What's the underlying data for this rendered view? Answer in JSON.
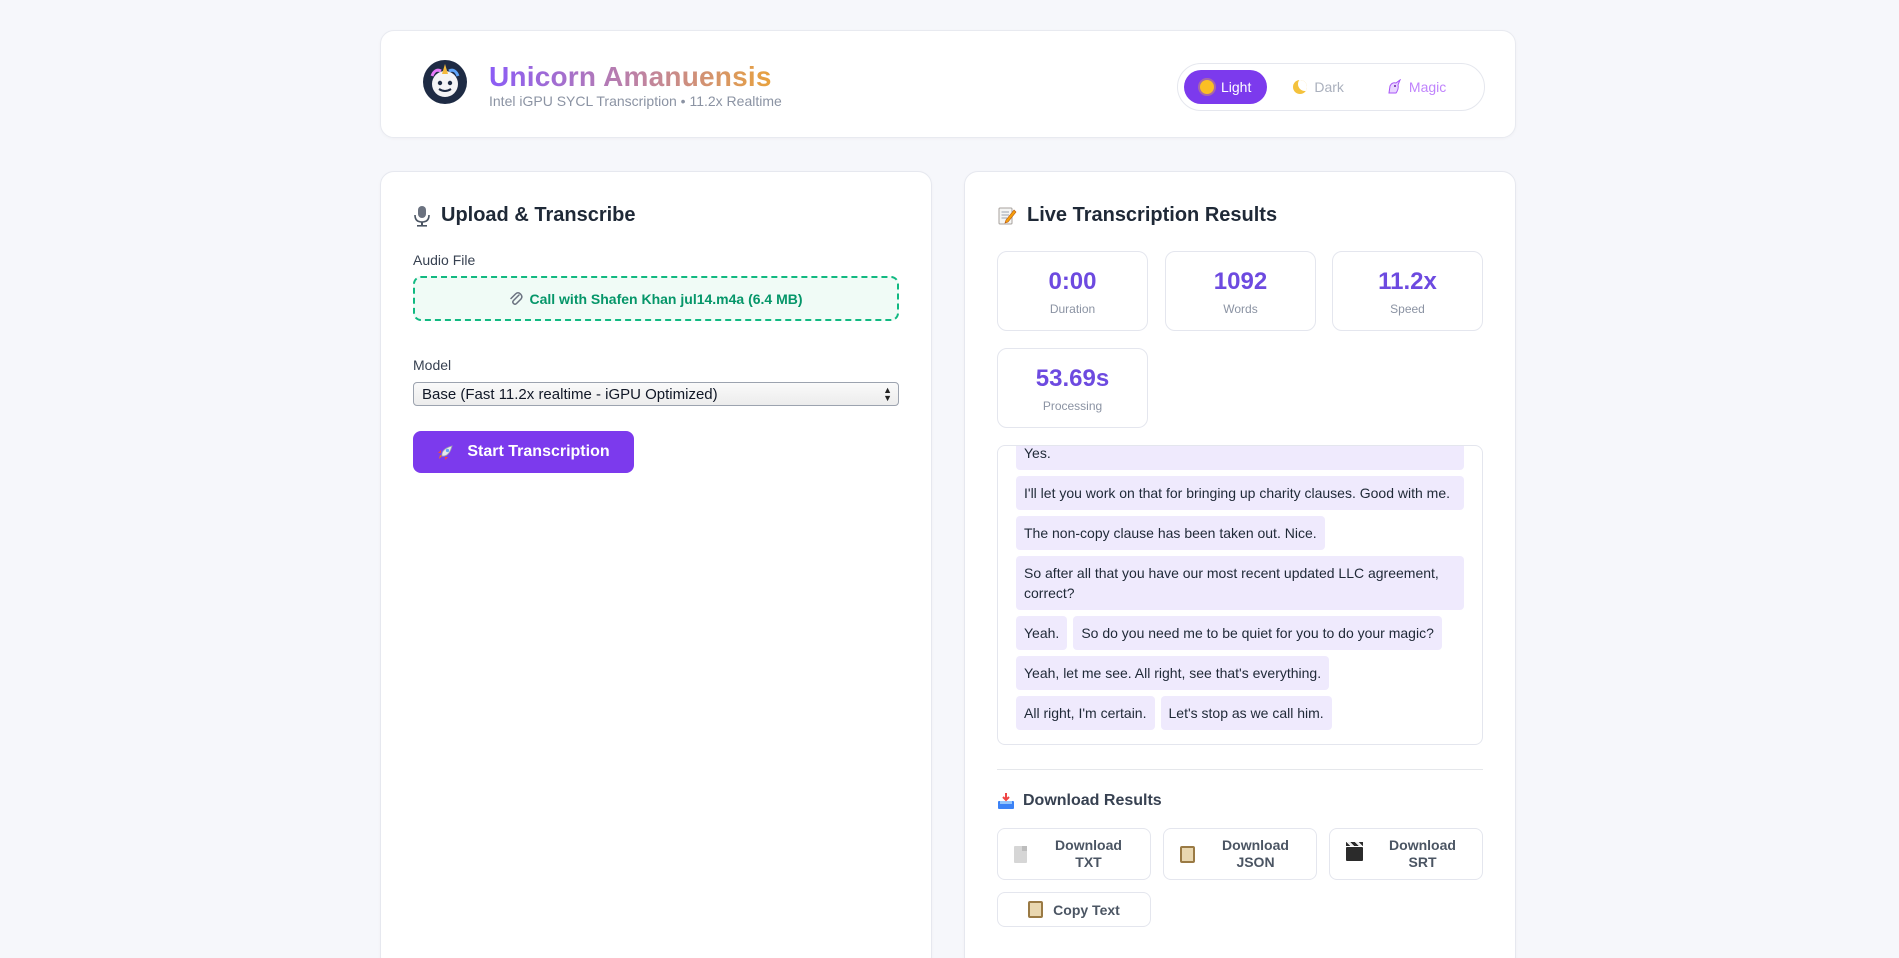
{
  "header": {
    "title": "Unicorn Amanuensis",
    "subtitle": "Intel iGPU SYCL Transcription • 11.2x Realtime",
    "themes": [
      {
        "label": "Light",
        "icon": "sun-icon",
        "active": true
      },
      {
        "label": "Dark",
        "icon": "moon-icon",
        "active": false
      },
      {
        "label": "Magic",
        "icon": "unicorn-icon",
        "active": false
      }
    ]
  },
  "upload": {
    "title": "Upload & Transcribe",
    "title_icon": "microphone-icon",
    "audio_label": "Audio File",
    "file_name": "Call with Shafen Khan jul14.m4a (6.4 MB)",
    "file_icon": "paperclip-icon",
    "model_label": "Model",
    "model_value": "Base (Fast 11.2x realtime - iGPU Optimized)",
    "start_label": "Start Transcription",
    "start_icon": "rocket-icon"
  },
  "results": {
    "title": "Live Transcription Results",
    "title_icon": "memo-icon",
    "stats": [
      {
        "value": "0:00",
        "label": "Duration"
      },
      {
        "value": "1092",
        "label": "Words"
      },
      {
        "value": "11.2x",
        "label": "Speed"
      },
      {
        "value": "53.69s",
        "label": "Processing"
      }
    ],
    "segments": [
      {
        "text": "Yes.",
        "full": true
      },
      {
        "text": "I'll let you work on that for bringing up charity clauses. Good with me.",
        "full": true
      },
      {
        "text": "The non-copy clause has been taken out. Nice.",
        "full": false
      },
      {
        "text": "So after all that you have our most recent updated LLC agreement, correct?",
        "full": true
      },
      {
        "text": "Yeah.",
        "full": false
      },
      {
        "text": "So do you need me to be quiet for you to do your magic?",
        "full": false
      },
      {
        "text": "Yeah, let me see. All right, see that's everything.",
        "full": false
      },
      {
        "text": "All right, I'm certain.",
        "full": false
      },
      {
        "text": "Let's stop as we call him.",
        "full": false
      }
    ],
    "download_title": "Download Results",
    "download_icon": "inbox-tray-icon",
    "downloads": [
      {
        "line1": "Download",
        "line2": "TXT",
        "icon": "document-icon"
      },
      {
        "line1": "Download",
        "line2": "JSON",
        "icon": "clipboard-icon"
      },
      {
        "line1": "Download",
        "line2": "SRT",
        "icon": "clapperboard-icon"
      }
    ],
    "copy_label": "Copy Text",
    "copy_icon": "clipboard-icon"
  },
  "colors": {
    "accent": "#7c3aed",
    "stat_value": "#6d4ae0",
    "file_border": "#10b981",
    "segment_bg": "#efeafd"
  }
}
